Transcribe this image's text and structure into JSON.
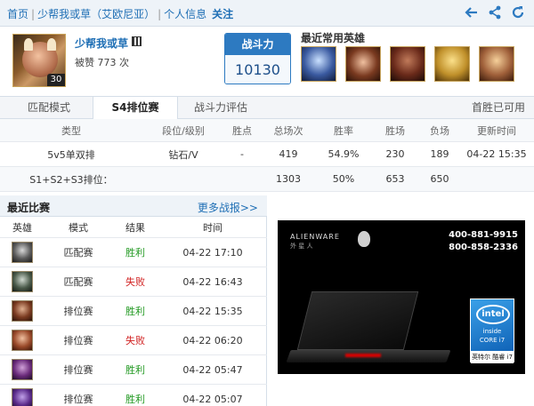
{
  "nav": {
    "home": "首页",
    "summoner_server": "少帮我或草（艾欧尼亚）",
    "section": "个人信息",
    "follow": "关注",
    "icons": [
      "back-arrow-icon",
      "share-icon",
      "refresh-icon"
    ]
  },
  "profile": {
    "name": "少帮我或草",
    "level": "30",
    "likes_text": "被赞 773 次",
    "power_label": "战斗力",
    "power_value": "10130",
    "heroes_title": "最近常用英雄"
  },
  "tabs": {
    "items": [
      "匹配模式",
      "S4排位赛",
      "战斗力评估"
    ],
    "active": "S4排位赛",
    "right_text": "首胜已可用"
  },
  "rank_table": {
    "headers": [
      "类型",
      "段位/级别",
      "胜点",
      "总场次",
      "胜率",
      "胜场",
      "负场",
      "更新时间"
    ],
    "rows": [
      [
        "5v5单双排",
        "钻石/V",
        "-",
        "419",
        "54.9%",
        "230",
        "189",
        "04-22 15:35"
      ],
      [
        "S1+S2+S3排位：",
        "",
        "",
        "1303",
        "50%",
        "653",
        "650",
        ""
      ]
    ]
  },
  "recent": {
    "title": "最近比赛",
    "more": "更多战报>>",
    "headers": [
      "英雄",
      "模式",
      "结果",
      "时间"
    ],
    "matches": [
      {
        "mode": "匹配赛",
        "result": "胜利",
        "time": "04-22 17:10",
        "outcome": "win"
      },
      {
        "mode": "匹配赛",
        "result": "失败",
        "time": "04-22 16:43",
        "outcome": "lose"
      },
      {
        "mode": "排位赛",
        "result": "胜利",
        "time": "04-22 15:35",
        "outcome": "win"
      },
      {
        "mode": "排位赛",
        "result": "失败",
        "time": "04-22 06:20",
        "outcome": "lose"
      },
      {
        "mode": "排位赛",
        "result": "胜利",
        "time": "04-22 05:47",
        "outcome": "win"
      },
      {
        "mode": "排位赛",
        "result": "胜利",
        "time": "04-22 05:07",
        "outcome": "win"
      }
    ]
  },
  "ad": {
    "brand": "ALIENWARE",
    "brand_cn": "外 星 人",
    "phone1": "400-881-9915",
    "phone2": "800-858-2336",
    "intel_logo": "intel",
    "intel_inside": "inside",
    "intel_core": "CORE i7",
    "intel_caption": "英特尔 酷睿 i7"
  },
  "colors": {
    "link": "#1f6fb5",
    "win": "#229922",
    "lose": "#d02020",
    "accent": "#2d7ac1"
  }
}
